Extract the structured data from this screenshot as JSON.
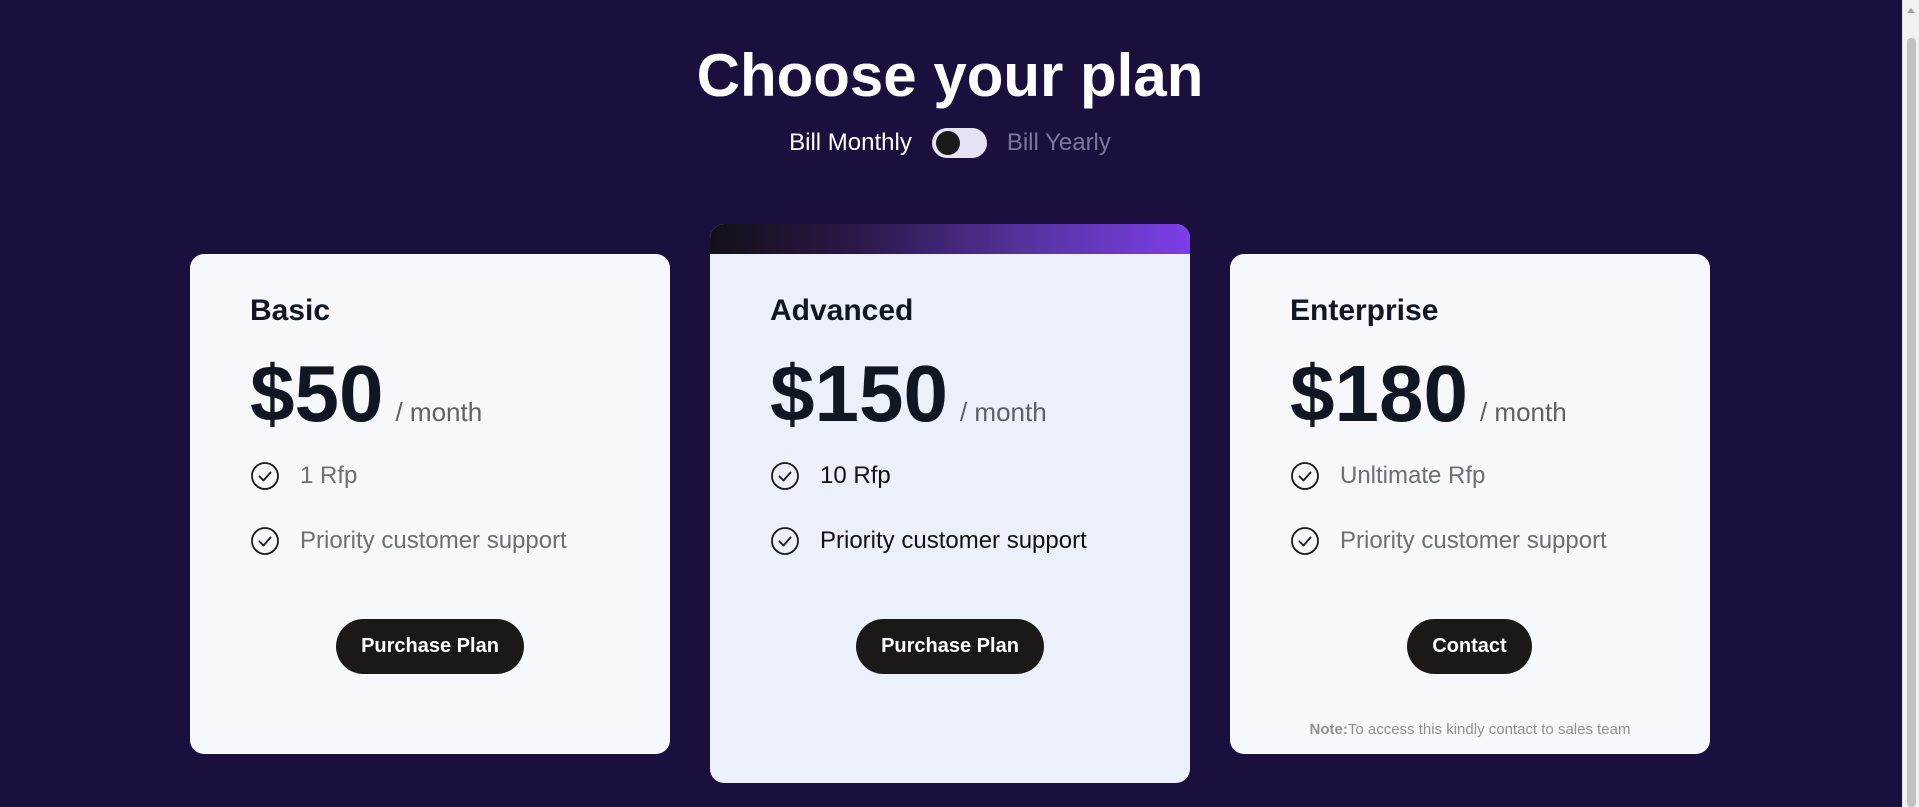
{
  "header": {
    "title": "Choose your plan"
  },
  "billing": {
    "monthly_label": "Bill Monthly",
    "yearly_label": "Bill Yearly",
    "selected": "monthly"
  },
  "plans": [
    {
      "name": "Basic",
      "price": "$50",
      "period": "/ month",
      "features": [
        "1 Rfp",
        "Priority customer support"
      ],
      "button_label": "Purchase Plan"
    },
    {
      "name": "Advanced",
      "price": "$150",
      "period": "/ month",
      "features": [
        "10 Rfp",
        "Priority customer support"
      ],
      "button_label": "Purchase Plan",
      "highlighted": true
    },
    {
      "name": "Enterprise",
      "price": "$180",
      "period": "/ month",
      "features": [
        "Unltimate Rfp",
        "Priority customer support"
      ],
      "button_label": "Contact",
      "note_label": "Note:",
      "note_text": "To access this kindly contact to sales team"
    }
  ],
  "colors": {
    "background": "#1b0f3d",
    "card": "#f7f8fb",
    "highlight_card": "#ecf0fb",
    "button": "#1a1918",
    "accent_gradient_end": "#7c3ee8"
  },
  "icons": {
    "feature": "check-circle-icon",
    "toggle": "toggle-switch"
  }
}
